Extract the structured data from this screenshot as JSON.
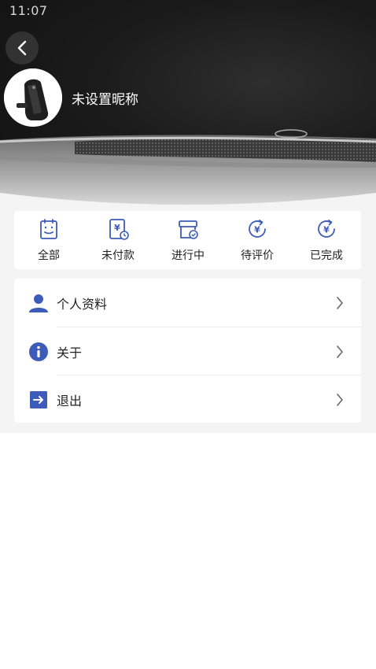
{
  "status_bar": {
    "time": "11:07"
  },
  "header": {
    "nickname": "未设置昵称",
    "back_icon": "chevron-left-icon"
  },
  "orders": {
    "items": [
      {
        "label": "全部",
        "icon": "clipboard-icon"
      },
      {
        "label": "未付款",
        "icon": "unpaid-bill-icon"
      },
      {
        "label": "进行中",
        "icon": "in-progress-box-icon"
      },
      {
        "label": "待评价",
        "icon": "pending-review-yen-icon"
      },
      {
        "label": "已完成",
        "icon": "completed-yen-icon"
      }
    ]
  },
  "menu": {
    "items": [
      {
        "label": "个人资料",
        "icon": "user-icon"
      },
      {
        "label": "关于",
        "icon": "info-icon"
      },
      {
        "label": "退出",
        "icon": "logout-arrow-icon"
      }
    ]
  },
  "colors": {
    "accent": "#3d5bb8",
    "page_background": "#f4f4f4",
    "card_background": "#ffffff"
  }
}
